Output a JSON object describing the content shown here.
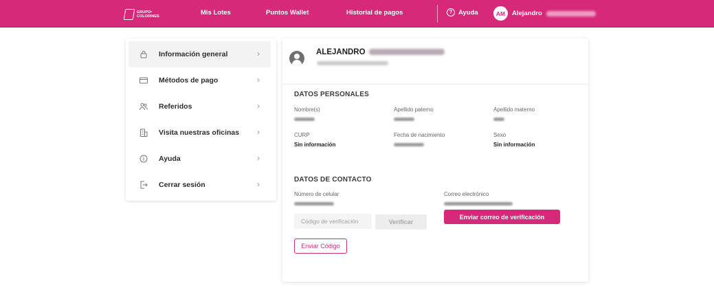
{
  "header": {
    "logo_line1": "GRUPO•",
    "logo_line2": "COLORINES",
    "nav": [
      "Mis Lotes",
      "Puntos Wallet",
      "Historial de pagos"
    ],
    "help_label": "Ayuda",
    "user_initials": "AM",
    "user_first_name": "Alejandro"
  },
  "sidebar": {
    "items": [
      {
        "label": "Información general",
        "icon": "lock-icon",
        "active": true
      },
      {
        "label": "Métodos de pago",
        "icon": "credit-card-icon"
      },
      {
        "label": "Referidos",
        "icon": "users-icon"
      },
      {
        "label": "Visita nuestras oficinas",
        "icon": "building-icon"
      },
      {
        "label": "Ayuda",
        "icon": "info-circle-icon"
      },
      {
        "label": "Cerrar sesión",
        "icon": "logout-icon"
      }
    ]
  },
  "profile": {
    "name": "ALEJANDRO"
  },
  "personal": {
    "title": "DATOS PERSONALES",
    "labels": {
      "nombre": "Nombre(s)",
      "apellido_paterno": "Apellido paterno",
      "apellido_materno": "Apellido materno",
      "curp": "CURP",
      "fecha_nacimiento": "Fecha de nacimiento",
      "sexo": "Sexo"
    },
    "values": {
      "curp": "Sin información",
      "sexo": "Sin información"
    }
  },
  "contact": {
    "title": "DATOS DE CONTACTO",
    "phone_label": "Número de celular",
    "email_label": "Correo electrónico",
    "code_placeholder": "Código de verificación",
    "verify_label": "Verificar",
    "send_email_label": "Enviar correo de verificación",
    "send_code_label": "Enviar Código"
  },
  "colors": {
    "brand": "#d6297a"
  }
}
